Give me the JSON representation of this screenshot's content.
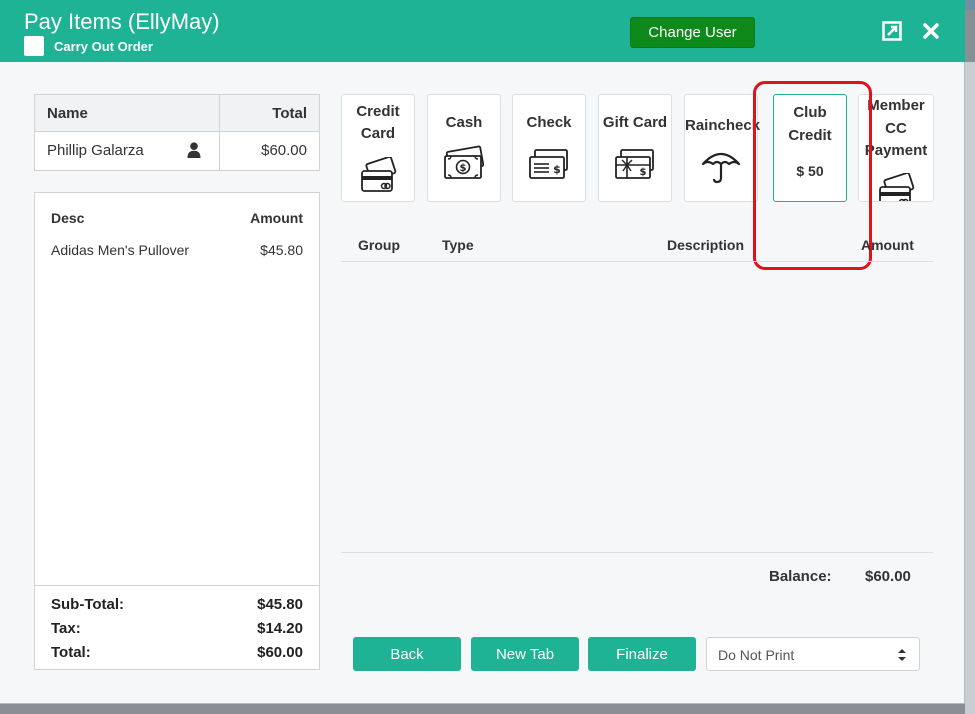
{
  "header": {
    "title": "Pay Items (EllyMay)",
    "subtitle": "Carry Out Order",
    "change_user_label": "Change User",
    "colors": {
      "header_bg": "#1db394",
      "change_user_bg": "#0d8a1a"
    },
    "icons": [
      "expand-icon",
      "close-icon"
    ]
  },
  "customer_table": {
    "headers": {
      "name": "Name",
      "total": "Total"
    },
    "row": {
      "name": "Phillip Galarza",
      "total": "$60.00",
      "icon": "user-icon"
    }
  },
  "items": {
    "headers": {
      "desc": "Desc",
      "amount": "Amount"
    },
    "rows": [
      {
        "desc": "Adidas Men's Pullover",
        "amount": "$45.80"
      }
    ],
    "totals": {
      "subtotal_label": "Sub-Total:",
      "subtotal": "$45.80",
      "tax_label": "Tax:",
      "tax": "$14.20",
      "total_label": "Total:",
      "total": "$60.00"
    }
  },
  "payment_methods": [
    {
      "label_lines": [
        "Credit",
        "Card"
      ],
      "icon": "credit-card-icon"
    },
    {
      "label_lines": [
        "Cash"
      ],
      "icon": "cash-icon"
    },
    {
      "label_lines": [
        "Check"
      ],
      "icon": "check-icon"
    },
    {
      "label_lines": [
        "Gift Card"
      ],
      "icon": "gift-card-icon"
    },
    {
      "label_lines": [
        "Raincheck"
      ],
      "icon": "umbrella-icon"
    },
    {
      "label_lines": [
        "Club",
        "Credit"
      ],
      "amount": "$ 50",
      "selected": true
    },
    {
      "label_lines": [
        "Member",
        "CC",
        "Payment"
      ],
      "icon": "credit-card-icon"
    }
  ],
  "payments_grid": {
    "headers": {
      "group": "Group",
      "type": "Type",
      "description": "Description",
      "amount": "Amount"
    }
  },
  "balance": {
    "label": "Balance:",
    "value": "$60.00"
  },
  "actions": {
    "back": "Back",
    "new_tab": "New Tab",
    "finalize": "Finalize",
    "print_option": "Do Not Print"
  },
  "annotation": {
    "highlight_color": "#e0121a"
  }
}
